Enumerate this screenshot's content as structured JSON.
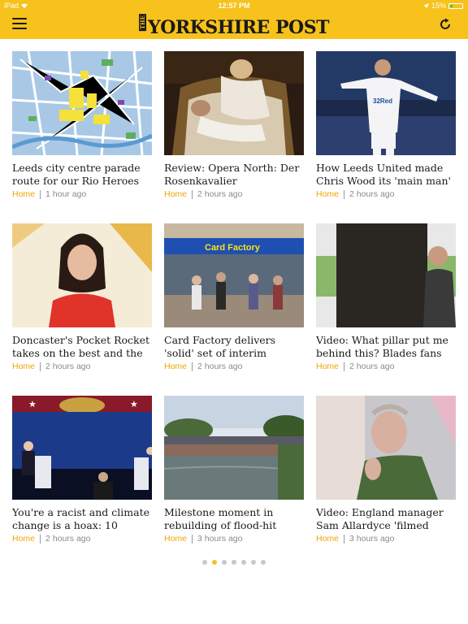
{
  "status_bar": {
    "carrier": "iPad",
    "time": "12:57 PM",
    "battery": "15%"
  },
  "header": {
    "logo_prefix": "THE",
    "logo_text": "YORKSHIRE POST",
    "menu_icon": "hamburger-icon",
    "refresh_icon": "refresh-icon",
    "accent_color": "#f7c21b"
  },
  "articles": [
    {
      "headline": "Leeds city centre parade route for our Rio Heroes",
      "section": "Home",
      "time": "1 hour ago",
      "image": "city-map"
    },
    {
      "headline": "Review: Opera North: Der Rosenkavalier",
      "section": "Home",
      "time": "2 hours ago",
      "image": "opera-stage"
    },
    {
      "headline": "How Leeds United made Chris Wood its 'main man'",
      "section": "Home",
      "time": "2 hours ago",
      "image": "footballer"
    },
    {
      "headline": "Doncaster's Pocket Rocket takes on the best and the b...",
      "section": "Home",
      "time": "2 hours ago",
      "image": "woman-portrait"
    },
    {
      "headline": "Card Factory delivers 'solid' set of interim results",
      "section": "Home",
      "time": "2 hours ago",
      "image": "shopfront"
    },
    {
      "headline": "Video: What pillar put me behind this? Blades fans se...",
      "section": "Home",
      "time": "2 hours ago",
      "image": "stadium-pillar"
    },
    {
      "headline": "You're a racist and climate change is a hoax: 10 takea...",
      "section": "Home",
      "time": "2 hours ago",
      "image": "debate-stage"
    },
    {
      "headline": "Milestone moment in rebuilding of flood-hit Ella...",
      "section": "Home",
      "time": "3 hours ago",
      "image": "river-bridge"
    },
    {
      "headline": "Video: England manager Sam Allardyce 'filmed sho...",
      "section": "Home",
      "time": "3 hours ago",
      "image": "man-video"
    }
  ],
  "pager": {
    "count": 7,
    "active_index": 1
  }
}
